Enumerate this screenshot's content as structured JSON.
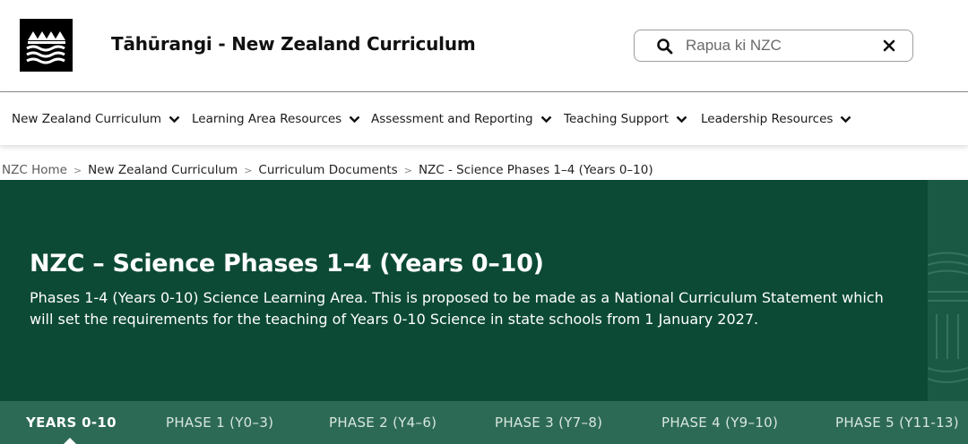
{
  "header": {
    "site_title": "Tāhūrangi - New Zealand Curriculum",
    "logo_icon": "mountains-waves-logo"
  },
  "search": {
    "placeholder": "Rapua ki NZC",
    "value": "",
    "search_icon": "search-icon",
    "clear_icon": "close-icon"
  },
  "nav": {
    "items": [
      {
        "label": "New Zealand Curriculum"
      },
      {
        "label": "Learning Area Resources"
      },
      {
        "label": "Assessment and Reporting"
      },
      {
        "label": "Teaching Support"
      },
      {
        "label": "Leadership Resources"
      }
    ]
  },
  "breadcrumb": {
    "items": [
      {
        "label": "NZC Home"
      },
      {
        "label": "New Zealand Curriculum"
      },
      {
        "label": "Curriculum Documents"
      },
      {
        "label": "NZC - Science Phases 1–4 (Years 0–10)"
      }
    ],
    "separator": ">"
  },
  "hero": {
    "title": "NZC – Science Phases 1–4 (Years 0–10)",
    "description": "Phases 1-4 (Years 0-10) Science Learning Area. This is proposed to be made as a National Curriculum Statement which will set the requirements for the teaching of Years 0-10 Science in state schools from 1 January 2027."
  },
  "tabs": {
    "items": [
      {
        "label": "YEARS 0-10",
        "active": true
      },
      {
        "label": "PHASE 1 (Y0–3)",
        "active": false
      },
      {
        "label": "PHASE 2 (Y4–6)",
        "active": false
      },
      {
        "label": "PHASE 3 (Y7–8)",
        "active": false
      },
      {
        "label": "PHASE 4 (Y9–10)",
        "active": false
      },
      {
        "label": "PHASE 5 (Y11-13)",
        "active": false
      }
    ]
  },
  "colors": {
    "hero_bg": "#0c4a35",
    "tabs_bg": "#2d6a55",
    "text_dark": "#1a1a1a"
  }
}
